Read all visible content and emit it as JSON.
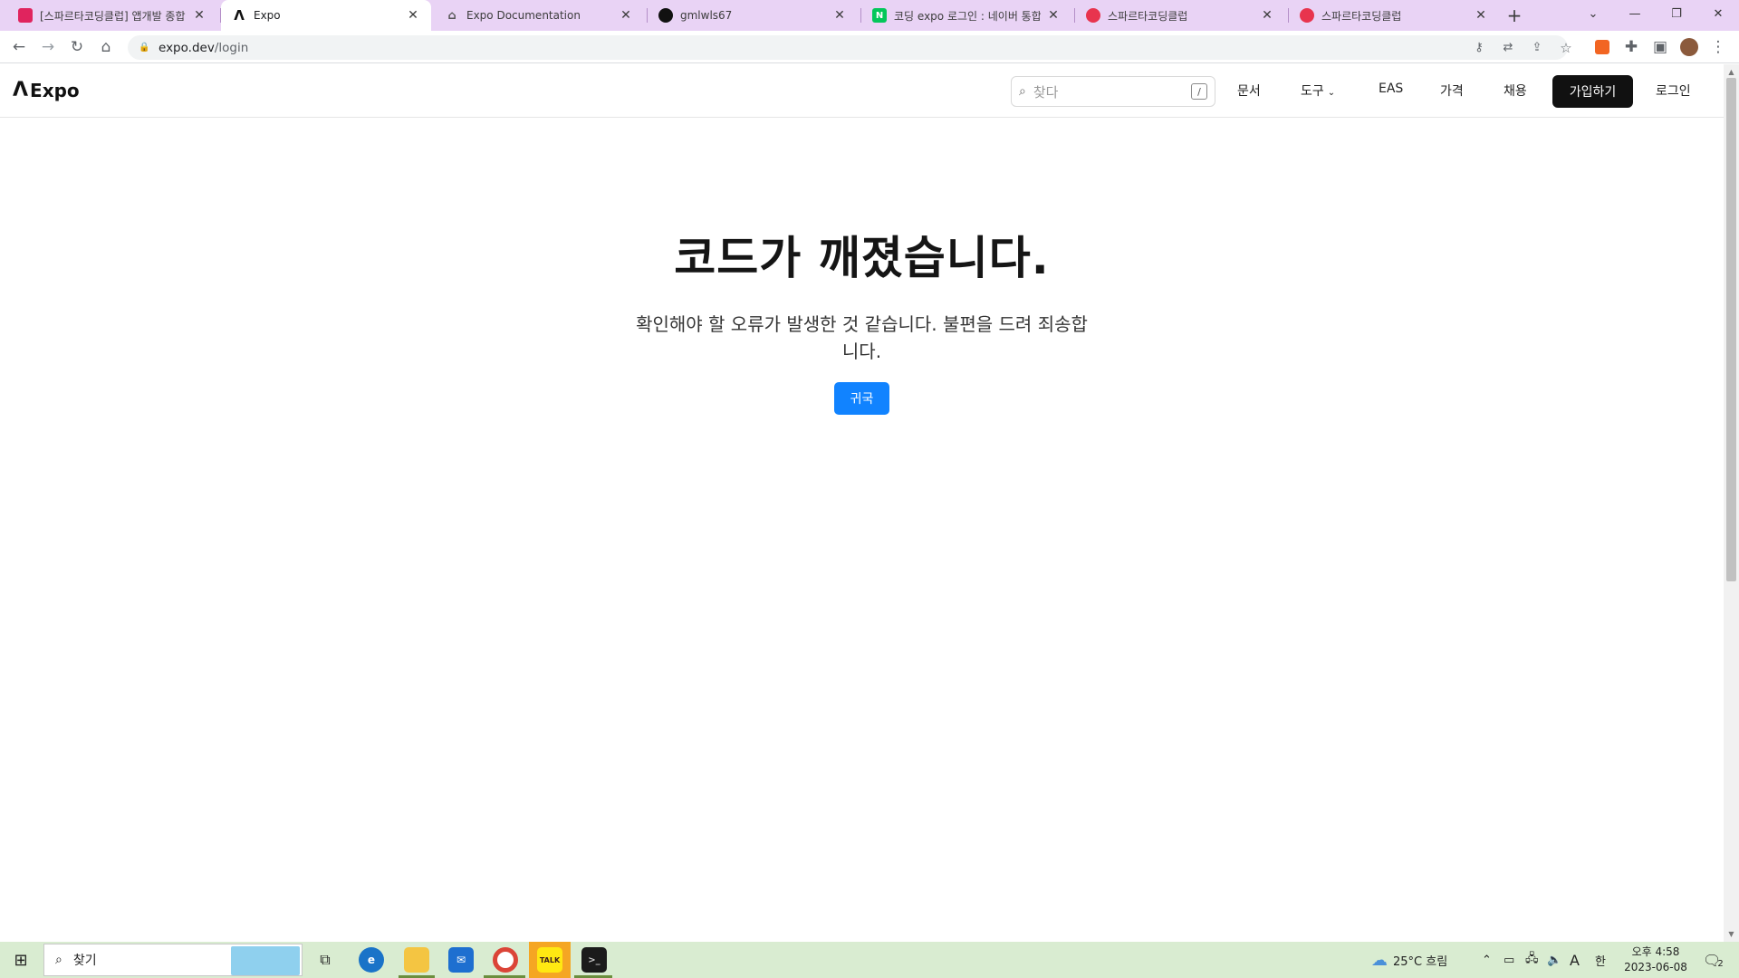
{
  "browser": {
    "tabs": [
      {
        "title": "[스파르타코딩클럽] 앱개발 종합",
        "favicon": "sparta-book-icon",
        "color": "#e0245e",
        "active": false
      },
      {
        "title": "Expo",
        "favicon": "expo-logo-icon",
        "color": "#111111",
        "active": true
      },
      {
        "title": "Expo Documentation",
        "favicon": "expo-docs-icon",
        "color": "#555555",
        "active": false
      },
      {
        "title": "gmlwls67",
        "favicon": "github-icon",
        "color": "#111111",
        "active": false
      },
      {
        "title": "코딩 expo 로그인 : 네이버 통합",
        "favicon": "naver-icon",
        "color": "#03c75a",
        "active": false
      },
      {
        "title": "스파르타코딩클럽",
        "favicon": "sparta-heart-icon",
        "color": "#e8344e",
        "active": false
      },
      {
        "title": "스파르타코딩클럽",
        "favicon": "sparta-heart-icon",
        "color": "#e8344e",
        "active": false
      }
    ],
    "url_host": "expo.dev",
    "url_path": "/login"
  },
  "page": {
    "brand": "Expo",
    "search_placeholder": "찾다",
    "search_shortcut": "/",
    "nav": {
      "docs": "문서",
      "tools": "도구",
      "eas": "EAS",
      "pricing": "가격",
      "careers": "채용",
      "signup": "가입하기",
      "login": "로그인"
    },
    "error_title": "코드가 깨졌습니다.",
    "error_message": "확인해야 할 오류가 발생한 것 같습니다. 불편을 드려 죄송합니다.",
    "home_button": "귀국"
  },
  "taskbar": {
    "search_placeholder": "찾기",
    "weather": "25°C 흐림",
    "ime_lang": "A",
    "ime_mode": "한",
    "time": "오후 4:58",
    "date": "2023-06-08",
    "notification_count": "2"
  },
  "colors": {
    "tabstrip_bg": "#e9d3f5",
    "primary_button": "#1183ff",
    "taskbar_bg": "#d9ecd1"
  }
}
